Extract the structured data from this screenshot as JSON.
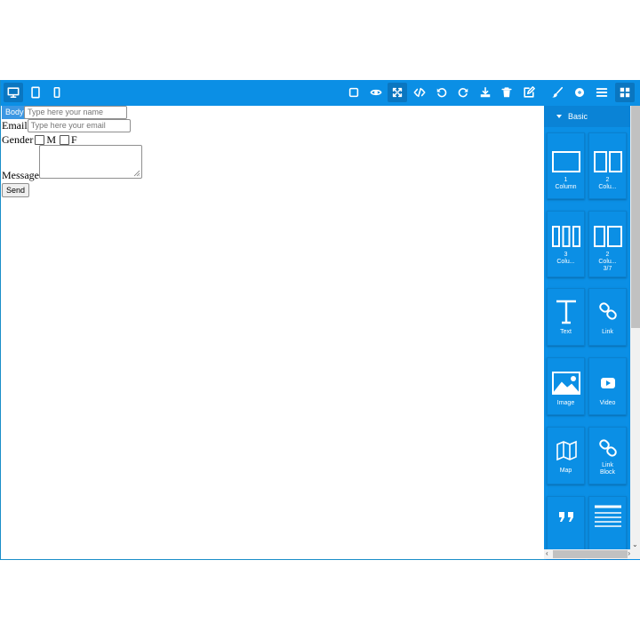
{
  "toolbar": {
    "devices": [
      {
        "name": "desktop-icon",
        "active": true
      },
      {
        "name": "tablet-icon",
        "active": false
      },
      {
        "name": "mobile-icon",
        "active": false
      }
    ],
    "options": [
      "sw-visibility-icon",
      "preview-eye-icon",
      "fullscreen-icon",
      "code-icon",
      "undo-icon",
      "redo-icon",
      "import-download-icon",
      "trash-icon",
      "edit-icon"
    ],
    "panels": [
      "paint-brush-icon",
      "gear-icon",
      "layers-menu-icon",
      "blocks-grid-icon"
    ]
  },
  "canvas": {
    "badge": "Body",
    "form": {
      "name_placeholder": "Type here your name",
      "email_label": "Email",
      "email_placeholder": "Type here your email",
      "gender_label": "Gender",
      "gender_m": "M",
      "gender_f": "F",
      "message_label": "Message",
      "send_label": "Send"
    }
  },
  "blocks": {
    "category": "Basic",
    "items": [
      {
        "id": "1col",
        "label": "1\nColumn",
        "icon": "one-column-icon"
      },
      {
        "id": "2col",
        "label": "2\nColu...",
        "icon": "two-column-icon"
      },
      {
        "id": "3col",
        "label": "3\nColu...",
        "icon": "three-column-icon"
      },
      {
        "id": "2col37",
        "label": "2\nColu...\n3/7",
        "icon": "two-column-37-icon"
      },
      {
        "id": "text",
        "label": "Text",
        "icon": "text-icon"
      },
      {
        "id": "link",
        "label": "Link",
        "icon": "link-icon"
      },
      {
        "id": "image",
        "label": "Image",
        "icon": "image-icon"
      },
      {
        "id": "video",
        "label": "Video",
        "icon": "video-icon"
      },
      {
        "id": "map",
        "label": "Map",
        "icon": "map-icon"
      },
      {
        "id": "linkblock",
        "label": "Link\nBlock",
        "icon": "link-block-icon"
      },
      {
        "id": "quote",
        "label": "",
        "icon": "quote-icon"
      },
      {
        "id": "textsection",
        "label": "",
        "icon": "text-section-icon"
      }
    ]
  },
  "colors": {
    "primary": "#0b8fe5",
    "active": "#0a76c0",
    "badge": "#3b97e3"
  }
}
